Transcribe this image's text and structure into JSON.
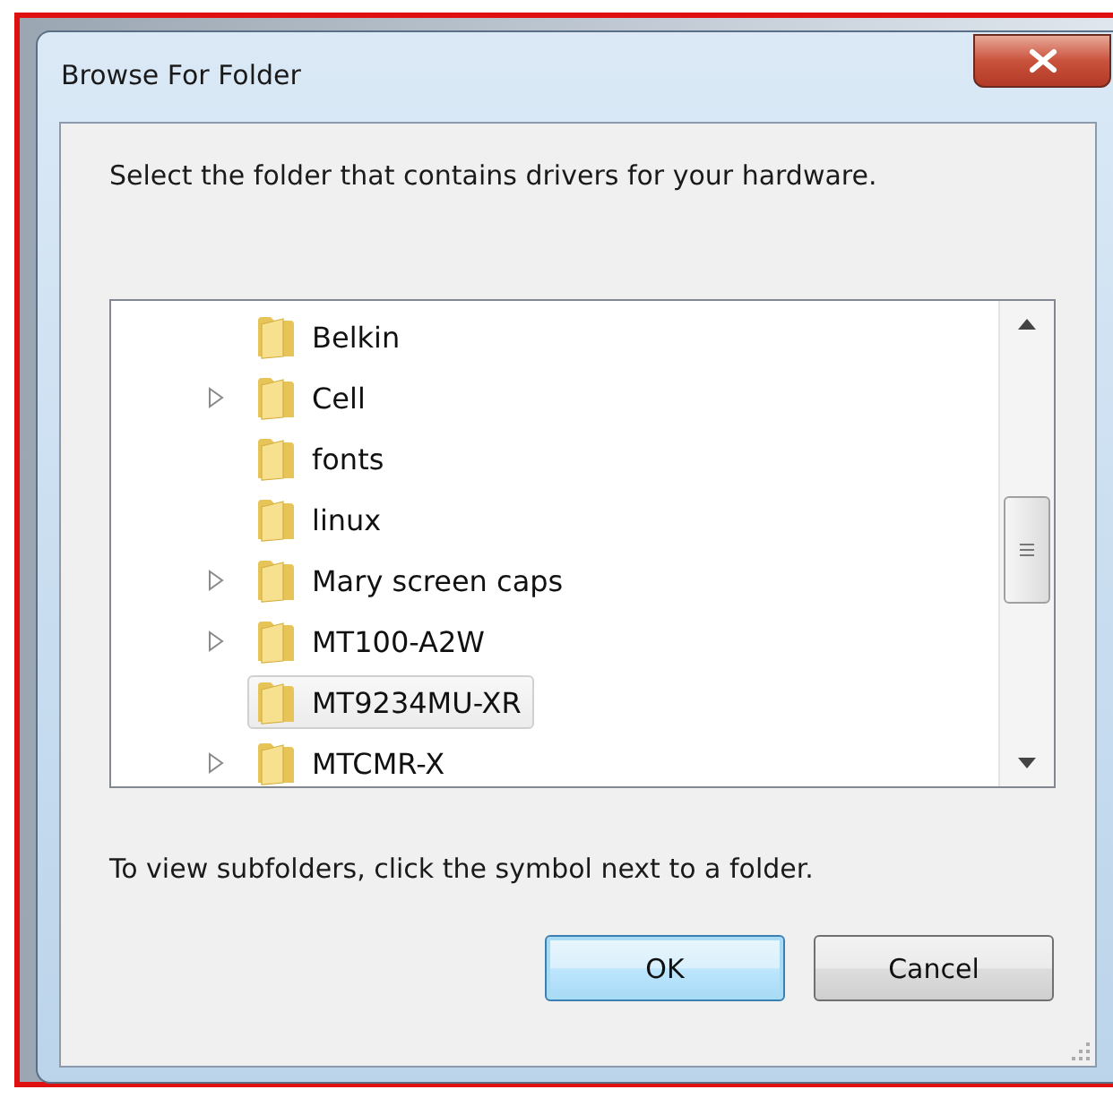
{
  "window": {
    "title": "Browse For Folder"
  },
  "instruction": "Select the folder that contains drivers for your hardware.",
  "tree": {
    "items": [
      {
        "name": "Belkin",
        "expandable": false,
        "selected": false
      },
      {
        "name": "Cell",
        "expandable": true,
        "selected": false
      },
      {
        "name": "fonts",
        "expandable": false,
        "selected": false
      },
      {
        "name": "linux",
        "expandable": false,
        "selected": false
      },
      {
        "name": "Mary screen caps",
        "expandable": true,
        "selected": false
      },
      {
        "name": "MT100-A2W",
        "expandable": true,
        "selected": false
      },
      {
        "name": "MT9234MU-XR",
        "expandable": false,
        "selected": true
      },
      {
        "name": "MTCMR-X",
        "expandable": true,
        "selected": false
      }
    ]
  },
  "hint": "To view subfolders, click the symbol next to a folder.",
  "buttons": [
    {
      "label": "OK",
      "default": true
    },
    {
      "label": "Cancel",
      "default": false
    }
  ]
}
